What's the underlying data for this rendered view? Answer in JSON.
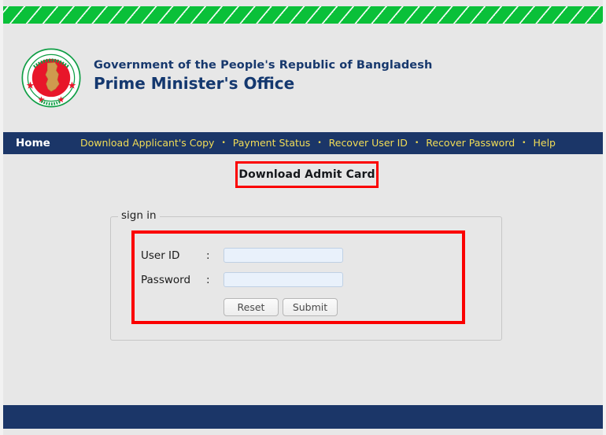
{
  "colors": {
    "band_green": "#0ac039",
    "nav_navy": "#1b3668",
    "nav_link_yellow": "#f2dd56",
    "heading_navy": "#17386d",
    "annotation_red": "#fb0000",
    "page_bg": "#e7e7e7",
    "input_bg": "#e9f1fb"
  },
  "header": {
    "emblem_name": "bangladesh-government-emblem",
    "emblem_ring_text_top": "গণপ্রজাতন্ত্রী বাংলাদেশ",
    "emblem_ring_text_bottom": "সরকার",
    "gov_line": "Government of the People's Republic of Bangladesh",
    "office_line": "Prime Minister's Office"
  },
  "nav": {
    "home_label": "Home",
    "separator": "•",
    "links": [
      {
        "label": "Download Applicant's Copy"
      },
      {
        "label": "Payment Status"
      },
      {
        "label": "Recover User ID"
      },
      {
        "label": "Recover Password"
      },
      {
        "label": "Help"
      }
    ]
  },
  "main": {
    "page_title": "Download Admit Card",
    "fieldset_legend": "sign in",
    "form": {
      "fields": [
        {
          "label": "User ID",
          "colon": ":",
          "value": "",
          "placeholder": ""
        },
        {
          "label": "Password",
          "colon": ":",
          "value": "",
          "placeholder": ""
        }
      ],
      "reset_label": "Reset",
      "submit_label": "Submit"
    }
  },
  "footer": {
    "text": ""
  }
}
